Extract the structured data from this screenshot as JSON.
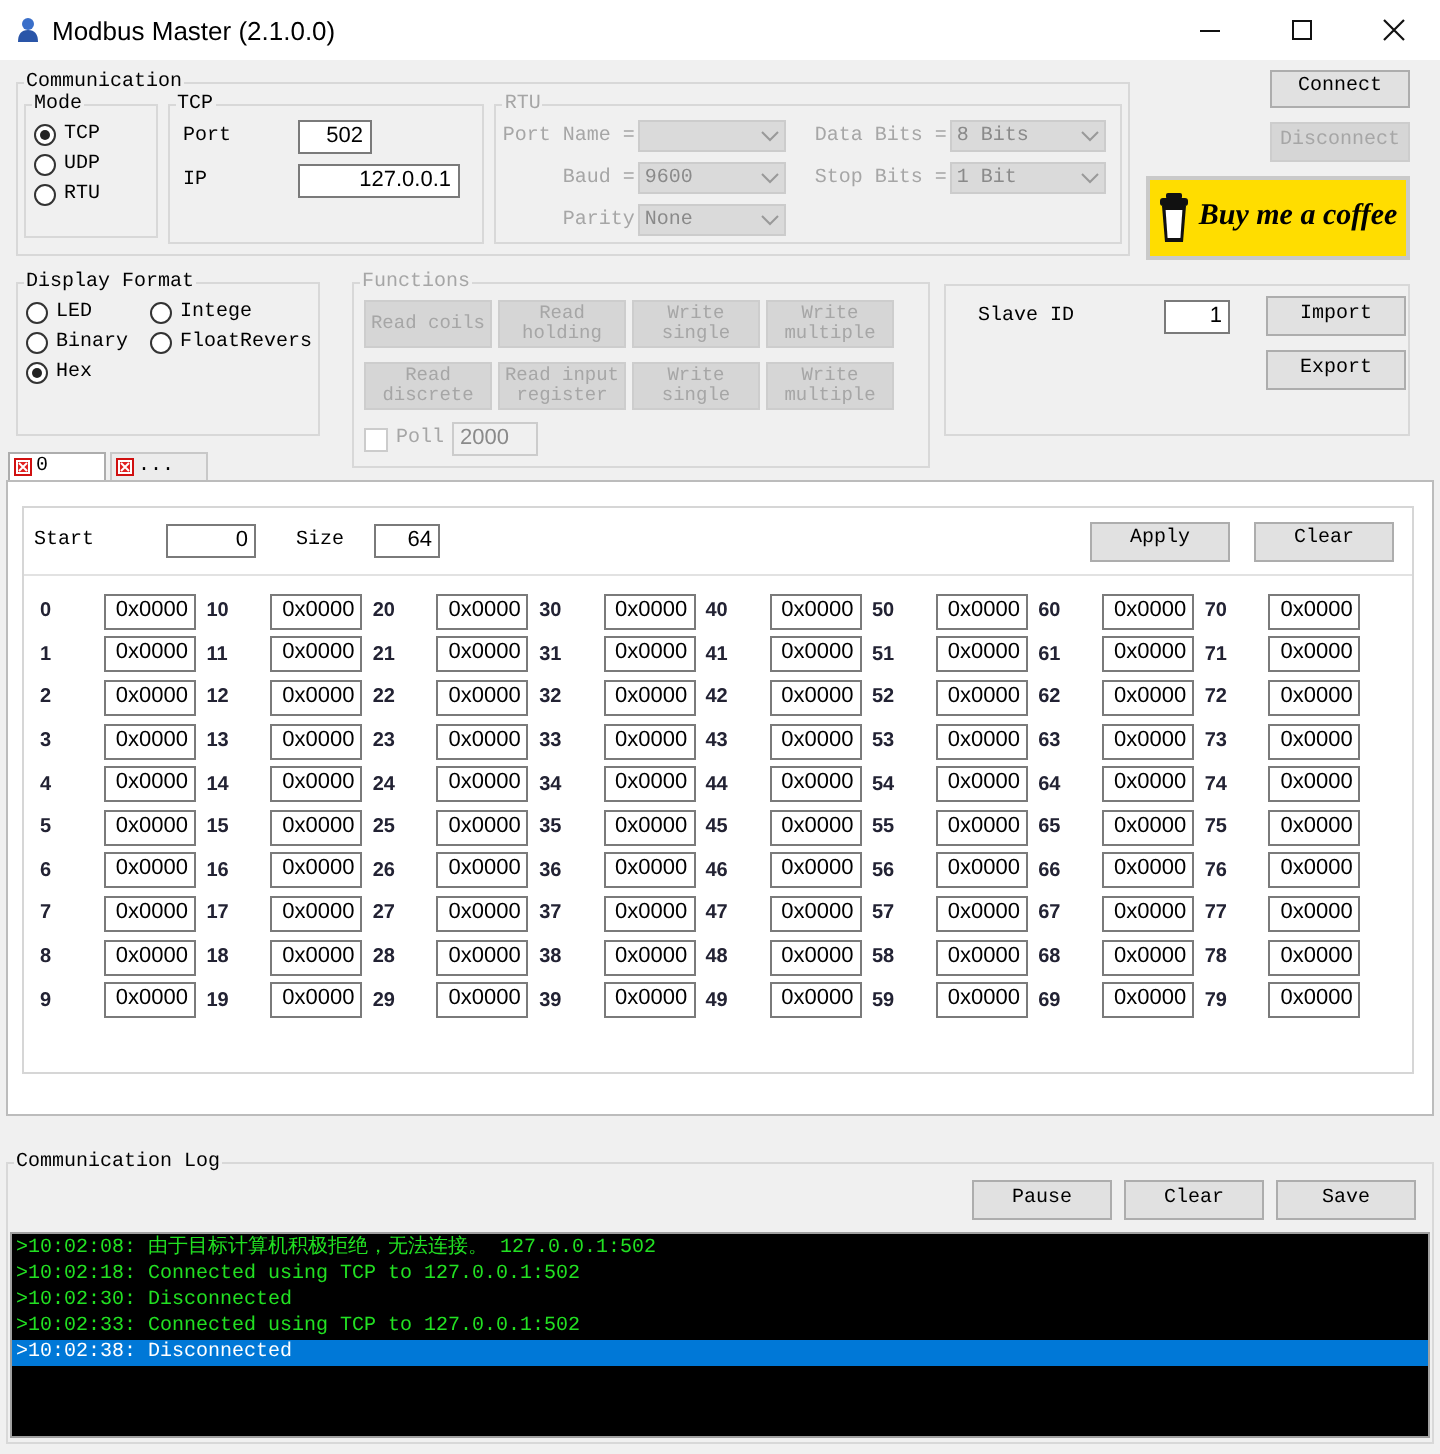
{
  "window": {
    "title": "Modbus Master (2.1.0.0)"
  },
  "communication": {
    "title": "Communication",
    "mode": {
      "title": "Mode",
      "options": [
        {
          "label": "TCP",
          "selected": true
        },
        {
          "label": "UDP",
          "selected": false
        },
        {
          "label": "RTU",
          "selected": false
        }
      ]
    },
    "tcp": {
      "title": "TCP",
      "port_label": "Port",
      "port": "502",
      "ip_label": "IP",
      "ip": "127.0.0.1"
    },
    "rtu": {
      "title": "RTU",
      "disabled": true,
      "fields": [
        {
          "label": "Port Name ="
        },
        {
          "label": "Data Bits =",
          "value": "8 Bits"
        },
        {
          "label": "Baud =",
          "value": "9600"
        },
        {
          "label": "Stop Bits =",
          "value": "1 Bit"
        },
        {
          "label": "Parity",
          "value": "None"
        }
      ]
    }
  },
  "connection_buttons": [
    {
      "label": "Connect",
      "disabled": false
    },
    {
      "label": "Disconnect",
      "disabled": true
    }
  ],
  "coffee_button": {
    "label": "Buy me a coffee"
  },
  "display_format": {
    "title": "Display Format",
    "options": [
      {
        "label": "LED",
        "selected": false
      },
      {
        "label": "Intege",
        "selected": false
      },
      {
        "label": "Binary",
        "selected": false
      },
      {
        "label": "FloatRevers",
        "selected": false
      },
      {
        "label": "Hex",
        "selected": true
      }
    ]
  },
  "functions": {
    "title": "Functions",
    "disabled": true,
    "buttons": [
      "Read coils",
      "Read holding",
      "Write single",
      "Write multiple",
      "Read discrete",
      "Read input register",
      "Write single",
      "Write multiple"
    ],
    "poll": {
      "label": "Poll",
      "checked": false,
      "interval": "2000"
    }
  },
  "slave": {
    "label": "Slave ID",
    "value": "1",
    "buttons": [
      "Import",
      "Export"
    ]
  },
  "tabs": [
    {
      "label": "0",
      "selected": true
    },
    {
      "label": "...",
      "selected": false
    }
  ],
  "registers": {
    "start_label": "Start",
    "start": "0",
    "size_label": "Size",
    "size": "64",
    "buttons": [
      "Apply",
      "Clear"
    ],
    "cells": [
      {
        "address": "0",
        "value": "0x0000"
      },
      {
        "address": "1",
        "value": "0x0000"
      },
      {
        "address": "2",
        "value": "0x0000"
      },
      {
        "address": "3",
        "value": "0x0000"
      },
      {
        "address": "4",
        "value": "0x0000"
      },
      {
        "address": "5",
        "value": "0x0000"
      },
      {
        "address": "6",
        "value": "0x0000"
      },
      {
        "address": "7",
        "value": "0x0000"
      },
      {
        "address": "8",
        "value": "0x0000"
      },
      {
        "address": "9",
        "value": "0x0000"
      },
      {
        "address": "10",
        "value": "0x0000"
      },
      {
        "address": "11",
        "value": "0x0000"
      },
      {
        "address": "12",
        "value": "0x0000"
      },
      {
        "address": "13",
        "value": "0x0000"
      },
      {
        "address": "14",
        "value": "0x0000"
      },
      {
        "address": "15",
        "value": "0x0000"
      },
      {
        "address": "16",
        "value": "0x0000"
      },
      {
        "address": "17",
        "value": "0x0000"
      },
      {
        "address": "18",
        "value": "0x0000"
      },
      {
        "address": "19",
        "value": "0x0000"
      },
      {
        "address": "20",
        "value": "0x0000"
      },
      {
        "address": "21",
        "value": "0x0000"
      },
      {
        "address": "22",
        "value": "0x0000"
      },
      {
        "address": "23",
        "value": "0x0000"
      },
      {
        "address": "24",
        "value": "0x0000"
      },
      {
        "address": "25",
        "value": "0x0000"
      },
      {
        "address": "26",
        "value": "0x0000"
      },
      {
        "address": "27",
        "value": "0x0000"
      },
      {
        "address": "28",
        "value": "0x0000"
      },
      {
        "address": "29",
        "value": "0x0000"
      },
      {
        "address": "30",
        "value": "0x0000"
      },
      {
        "address": "31",
        "value": "0x0000"
      },
      {
        "address": "32",
        "value": "0x0000"
      },
      {
        "address": "33",
        "value": "0x0000"
      },
      {
        "address": "34",
        "value": "0x0000"
      },
      {
        "address": "35",
        "value": "0x0000"
      },
      {
        "address": "36",
        "value": "0x0000"
      },
      {
        "address": "37",
        "value": "0x0000"
      },
      {
        "address": "38",
        "value": "0x0000"
      },
      {
        "address": "39",
        "value": "0x0000"
      },
      {
        "address": "40",
        "value": "0x0000"
      },
      {
        "address": "41",
        "value": "0x0000"
      },
      {
        "address": "42",
        "value": "0x0000"
      },
      {
        "address": "43",
        "value": "0x0000"
      },
      {
        "address": "44",
        "value": "0x0000"
      },
      {
        "address": "45",
        "value": "0x0000"
      },
      {
        "address": "46",
        "value": "0x0000"
      },
      {
        "address": "47",
        "value": "0x0000"
      },
      {
        "address": "48",
        "value": "0x0000"
      },
      {
        "address": "49",
        "value": "0x0000"
      },
      {
        "address": "50",
        "value": "0x0000"
      },
      {
        "address": "51",
        "value": "0x0000"
      },
      {
        "address": "52",
        "value": "0x0000"
      },
      {
        "address": "53",
        "value": "0x0000"
      },
      {
        "address": "54",
        "value": "0x0000"
      },
      {
        "address": "55",
        "value": "0x0000"
      },
      {
        "address": "56",
        "value": "0x0000"
      },
      {
        "address": "57",
        "value": "0x0000"
      },
      {
        "address": "58",
        "value": "0x0000"
      },
      {
        "address": "59",
        "value": "0x0000"
      },
      {
        "address": "60",
        "value": "0x0000"
      },
      {
        "address": "61",
        "value": "0x0000"
      },
      {
        "address": "62",
        "value": "0x0000"
      },
      {
        "address": "63",
        "value": "0x0000"
      },
      {
        "address": "64",
        "value": "0x0000"
      },
      {
        "address": "65",
        "value": "0x0000"
      },
      {
        "address": "66",
        "value": "0x0000"
      },
      {
        "address": "67",
        "value": "0x0000"
      },
      {
        "address": "68",
        "value": "0x0000"
      },
      {
        "address": "69",
        "value": "0x0000"
      },
      {
        "address": "70",
        "value": "0x0000"
      },
      {
        "address": "71",
        "value": "0x0000"
      },
      {
        "address": "72",
        "value": "0x0000"
      },
      {
        "address": "73",
        "value": "0x0000"
      },
      {
        "address": "74",
        "value": "0x0000"
      },
      {
        "address": "75",
        "value": "0x0000"
      },
      {
        "address": "76",
        "value": "0x0000"
      },
      {
        "address": "77",
        "value": "0x0000"
      },
      {
        "address": "78",
        "value": "0x0000"
      },
      {
        "address": "79",
        "value": "0x0000"
      }
    ]
  },
  "log": {
    "title": "Communication Log",
    "buttons": [
      "Pause",
      "Clear",
      "Save"
    ],
    "lines": [
      {
        "text": ">10:02:08: 由于目标计算机积极拒绝，无法连接。 127.0.0.1:502",
        "selected": false
      },
      {
        "text": ">10:02:18: Connected using TCP to 127.0.0.1:502",
        "selected": false
      },
      {
        "text": ">10:02:30: Disconnected",
        "selected": false
      },
      {
        "text": ">10:02:33: Connected using TCP to 127.0.0.1:502",
        "selected": false
      },
      {
        "text": ">10:02:38: Disconnected",
        "selected": true
      }
    ]
  }
}
